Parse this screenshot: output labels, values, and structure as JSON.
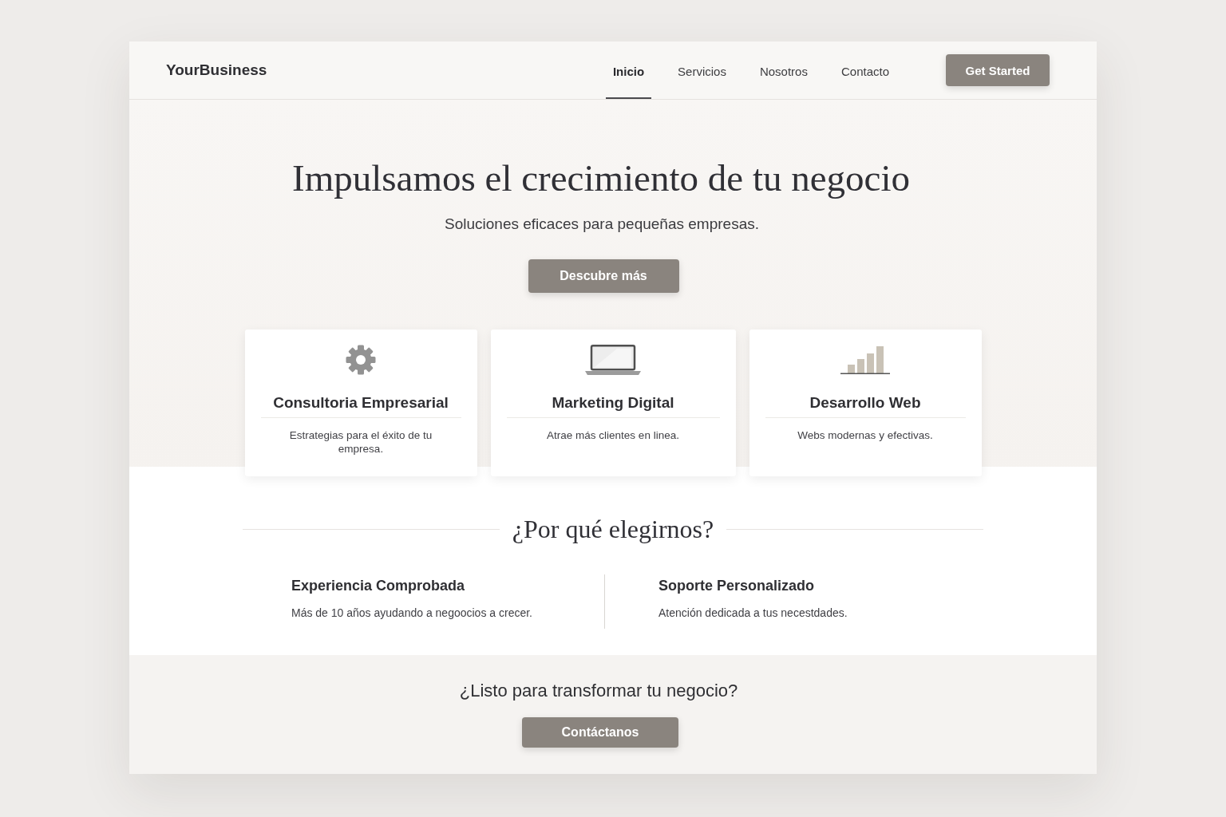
{
  "header": {
    "logo": "YourBusiness",
    "nav": [
      {
        "label": "Inicio",
        "selected": true
      },
      {
        "label": "Servicios",
        "selected": false
      },
      {
        "label": "Nosotros",
        "selected": false
      },
      {
        "label": "Contacto",
        "selected": false
      }
    ],
    "button": "Get Started"
  },
  "hero": {
    "title": "Impulsamos el crecimiento de tu negocio",
    "subtitle": "Soluciones eficaces para pequeñas empresas.",
    "button": "Descubre más"
  },
  "services": [
    {
      "kind": "gear",
      "title": "Consultoria Empresarial",
      "description": "Estrategias para el éxito de tu empresa."
    },
    {
      "kind": "laptop",
      "title": "Marketing Digital",
      "description": "Atrae más clientes en linea."
    },
    {
      "kind": "chart",
      "title": "Desarrollo Web",
      "description": "Webs modernas y efectivas."
    }
  ],
  "why_us": {
    "title": "¿Por qué elegirnos?",
    "points": [
      {
        "title": "Experiencia Comprobada",
        "description": "Más de 10 años ayudando a negoocios a crecer."
      },
      {
        "title": "Soporte Personalizado",
        "description": "Atención dedicada a tus necestdades."
      }
    ]
  },
  "cta": {
    "title": "¿Listo para transformar tu negocio?",
    "button": "Contáctanos"
  }
}
